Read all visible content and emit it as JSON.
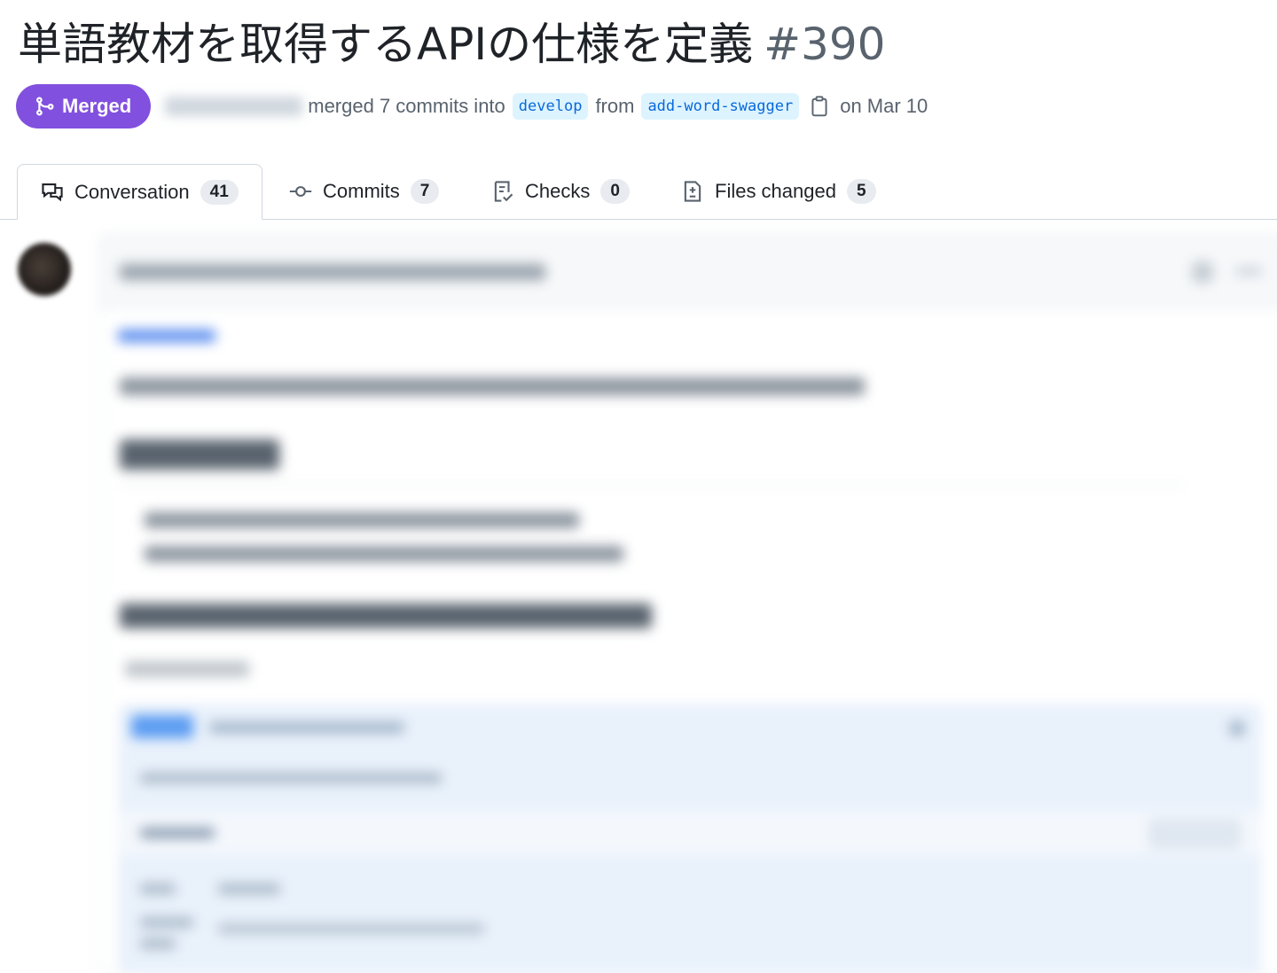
{
  "pr": {
    "title": "単語教材を取得するAPIの仕様を定義",
    "number": "#390",
    "state": "Merged",
    "merge_text": "merged 7 commits into",
    "base_branch": "develop",
    "from_text": "from",
    "head_branch": "add-word-swagger",
    "date_text": "on Mar 10"
  },
  "tabs": [
    {
      "label": "Conversation",
      "count": "41",
      "icon": "comment-discussion-icon"
    },
    {
      "label": "Commits",
      "count": "7",
      "icon": "git-commit-icon"
    },
    {
      "label": "Checks",
      "count": "0",
      "icon": "checklist-icon"
    },
    {
      "label": "Files changed",
      "count": "5",
      "icon": "file-diff-icon"
    }
  ],
  "colors": {
    "merged": "#8250df",
    "branch_bg": "#ddf4ff",
    "branch_text": "#0969da"
  }
}
